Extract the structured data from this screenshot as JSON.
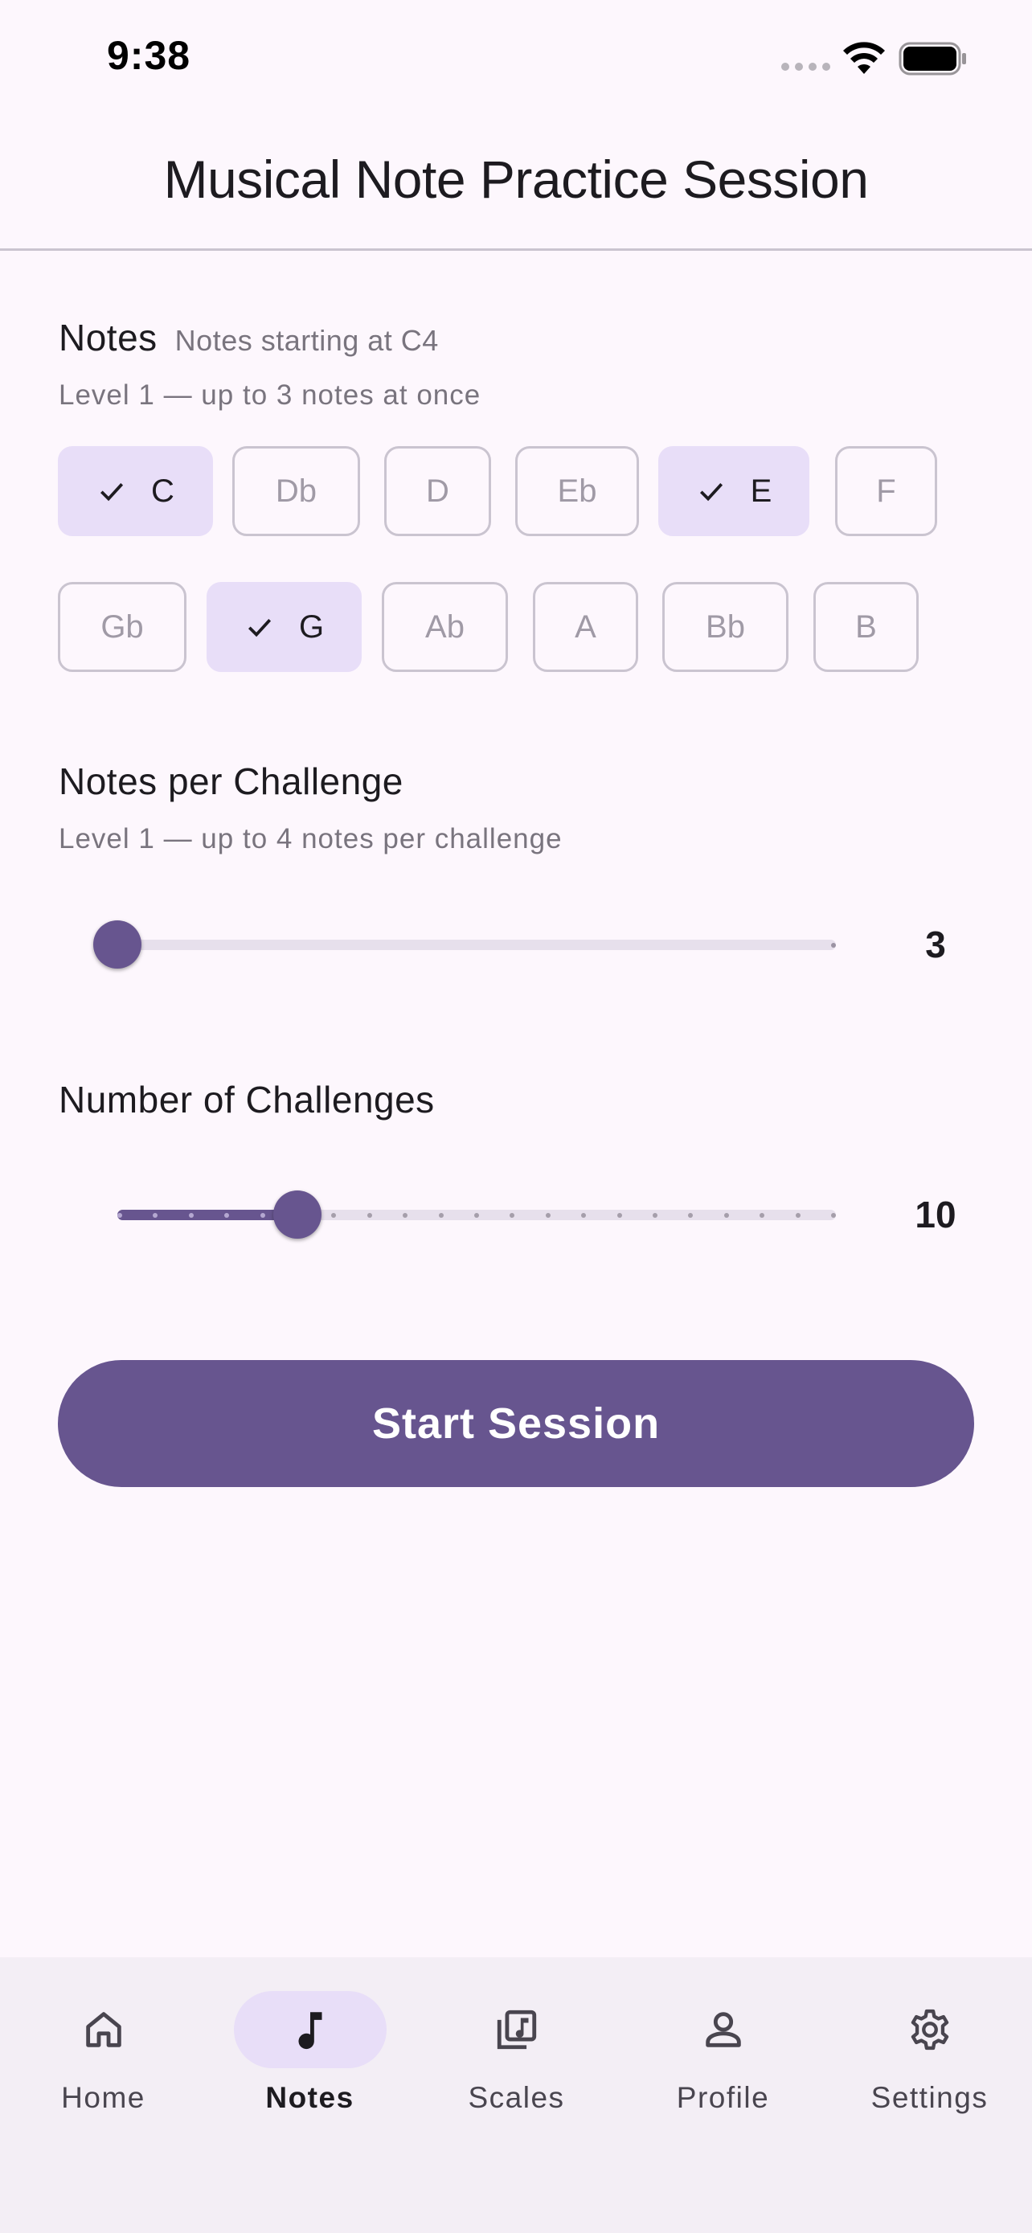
{
  "status_bar": {
    "time": "9:38"
  },
  "app_bar": {
    "title": "Musical Note Practice Session"
  },
  "notes_section": {
    "title": "Notes",
    "aside": "Notes starting at C4",
    "subtitle": "Level 1 — up to 3 notes at once",
    "chips": [
      {
        "label": "C",
        "selected": true
      },
      {
        "label": "Db",
        "selected": false
      },
      {
        "label": "D",
        "selected": false
      },
      {
        "label": "Eb",
        "selected": false
      },
      {
        "label": "E",
        "selected": true
      },
      {
        "label": "F",
        "selected": false
      },
      {
        "label": "Gb",
        "selected": false
      },
      {
        "label": "G",
        "selected": true
      },
      {
        "label": "Ab",
        "selected": false
      },
      {
        "label": "A",
        "selected": false
      },
      {
        "label": "Bb",
        "selected": false
      },
      {
        "label": "B",
        "selected": false
      }
    ]
  },
  "notes_per_challenge": {
    "title": "Notes per Challenge",
    "subtitle": "Level 1 — up to 4 notes per challenge",
    "value": "3",
    "slider_fraction": 0.0
  },
  "number_of_challenges": {
    "title": "Number of Challenges",
    "value": "10",
    "slider_fraction": 0.25,
    "tick_count": 21
  },
  "start_button": {
    "label": "Start Session"
  },
  "bottom_nav": {
    "items": [
      {
        "label": "Home",
        "icon": "home-icon",
        "active": false
      },
      {
        "label": "Notes",
        "icon": "music-note-icon",
        "active": true
      },
      {
        "label": "Scales",
        "icon": "music-library-icon",
        "active": false
      },
      {
        "label": "Profile",
        "icon": "person-icon",
        "active": false
      },
      {
        "label": "Settings",
        "icon": "gear-icon",
        "active": false
      }
    ]
  },
  "colors": {
    "primary": "#67558f",
    "secondary_container": "#e8def8",
    "background": "#fdf7fd",
    "nav_background": "#f3eef5"
  }
}
